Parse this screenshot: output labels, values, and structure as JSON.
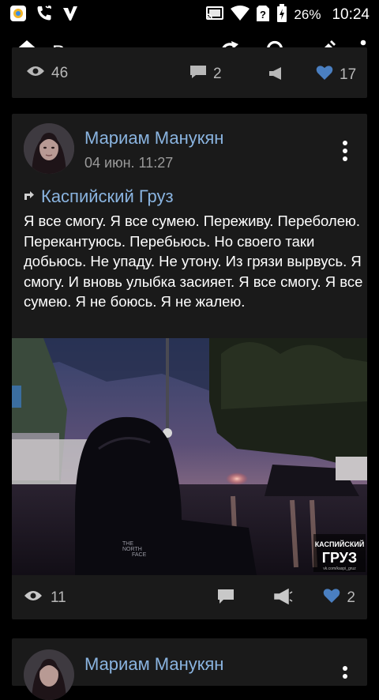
{
  "status_bar": {
    "battery": "26%",
    "time": "10:24",
    "icons": [
      "browser-icon",
      "missed-call-icon",
      "notification-icon",
      "cast-icon",
      "wifi-icon",
      "no-sim-icon",
      "battery-icon"
    ]
  },
  "toolbar": {
    "title": "Все записи",
    "icons": [
      "home-icon",
      "dropdown-caret-icon",
      "refresh-icon",
      "search-icon",
      "edit-icon",
      "more-icon"
    ]
  },
  "feed": {
    "previous_post": {
      "views": "46",
      "comments": "2",
      "likes": "17"
    },
    "post": {
      "author": "Мариам Манукян",
      "date": "04 июн. 11:27",
      "repost_source": "Каспийский Груз",
      "text": "Я все смогу. Я все сумею. Переживу. Переболею. Перекантуюсь. Перебьюсь. Но своего таки добьюсь. Не упаду. Не утону. Из грязи вырвусь. Я смогу. И вновь улыбка засияет. Я все смогу. Я все сумею. Я не боюсь. Я не жалею.",
      "photo_watermark_line1": "КАСПИЙСКИЙ",
      "photo_watermark_line2": "ГРУЗ",
      "photo_watermark_url": "vk.com/kaspi_gruz",
      "jacket_brand_line1": "THE",
      "jacket_brand_line2": "NORTH",
      "jacket_brand_line3": "FACE",
      "views": "11",
      "likes": "2"
    },
    "next_post": {
      "author": "Мариам Манукян"
    }
  },
  "colors": {
    "background": "#000000",
    "card": "#1a1a1a",
    "link": "#8ab4e0",
    "like": "#4a7fc1",
    "muted": "#9a9a9a"
  }
}
